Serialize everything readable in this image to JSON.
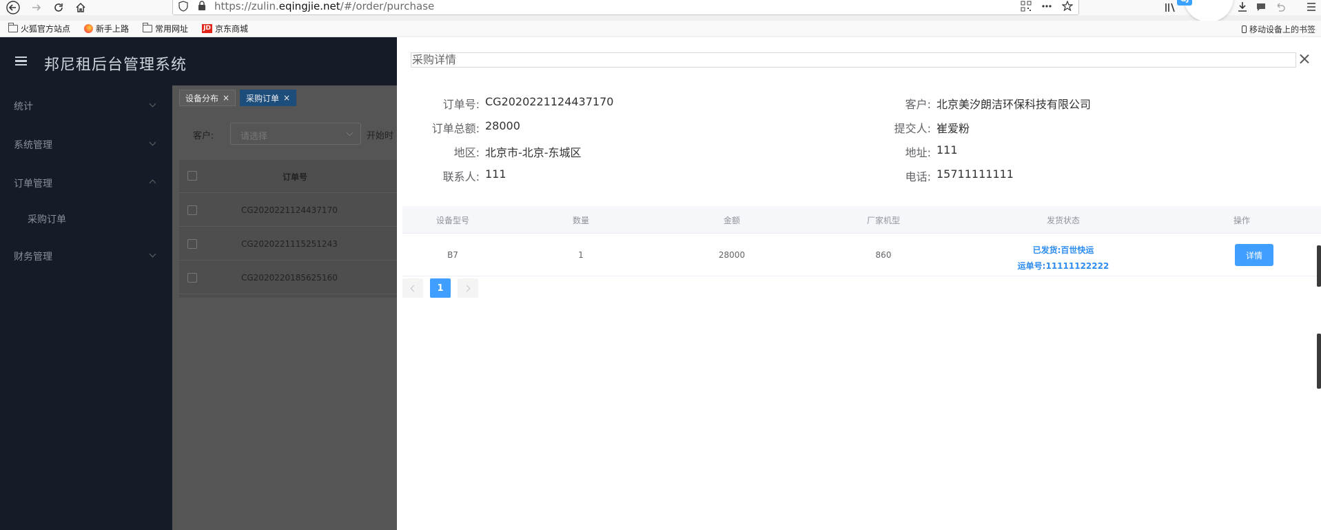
{
  "browser": {
    "url_prefix": "https://zulin.",
    "url_domain": "eqingjie.net",
    "url_path": "/#/order/purchase",
    "avatar_badge": "GJ",
    "bookmarks": [
      "火狐官方站点",
      "新手上路",
      "常用网址",
      "京东商城"
    ],
    "jd_label": "JD",
    "mobile_bookmarks": "移动设备上的书签"
  },
  "app": {
    "title": "邦尼租后台管理系统",
    "sidebar": [
      {
        "label": "统计"
      },
      {
        "label": "系统管理"
      },
      {
        "label": "订单管理"
      },
      {
        "label": "采购订单"
      },
      {
        "label": "财务管理"
      }
    ],
    "tabs": [
      "设备分布",
      "采购订单"
    ],
    "filter": {
      "customer_label": "客户:",
      "customer_placeholder": "请选择",
      "start_label": "开始时"
    },
    "table": {
      "header": "订单号",
      "rows": [
        "CG2020221124437170",
        "CG2020221115251243",
        "CG2020220185625160"
      ]
    }
  },
  "drawer": {
    "title": "采购详情",
    "info": {
      "order_no_label": "订单号:",
      "order_no": "CG2020221124437170",
      "customer_label": "客户:",
      "customer": "北京美汐朗洁环保科技有限公司",
      "total_label": "订单总额:",
      "total": "28000",
      "submitter_label": "提交人:",
      "submitter": "崔爱粉",
      "region_label": "地区:",
      "region": "北京市-北京-东城区",
      "address_label": "地址:",
      "address": "111",
      "contact_label": "联系人:",
      "contact": "111",
      "phone_label": "电话:",
      "phone": "15711111111"
    },
    "table": {
      "headers": [
        "设备型号",
        "数量",
        "金额",
        "厂家机型",
        "发货状态",
        "操作"
      ],
      "row": {
        "model": "B7",
        "quantity": "1",
        "amount": "28000",
        "maker_model": "860",
        "ship_status": "已发货:百世快运",
        "tracking": "运单号:11111122222",
        "action": "详情"
      }
    },
    "pagination": {
      "current": "1"
    }
  }
}
